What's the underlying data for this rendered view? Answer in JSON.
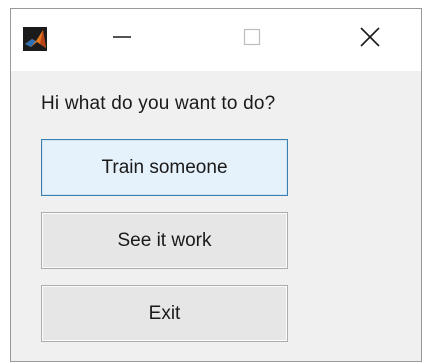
{
  "window": {
    "icon": "matlab-icon",
    "controls": {
      "minimize": "minimize-icon",
      "maximize": "maximize-icon",
      "close": "close-icon"
    }
  },
  "dialog": {
    "prompt": "Hi what do you want to do?",
    "buttons": [
      {
        "label": "Train someone",
        "focused": true
      },
      {
        "label": "See it work",
        "focused": false
      },
      {
        "label": "Exit",
        "focused": false
      }
    ]
  },
  "colors": {
    "dialog_background": "#f0f0f0",
    "titlebar_background": "#ffffff",
    "button_background": "#e6e6e6",
    "focused_button_background": "#e5f1fb",
    "focused_button_border": "#3c7fb1"
  }
}
